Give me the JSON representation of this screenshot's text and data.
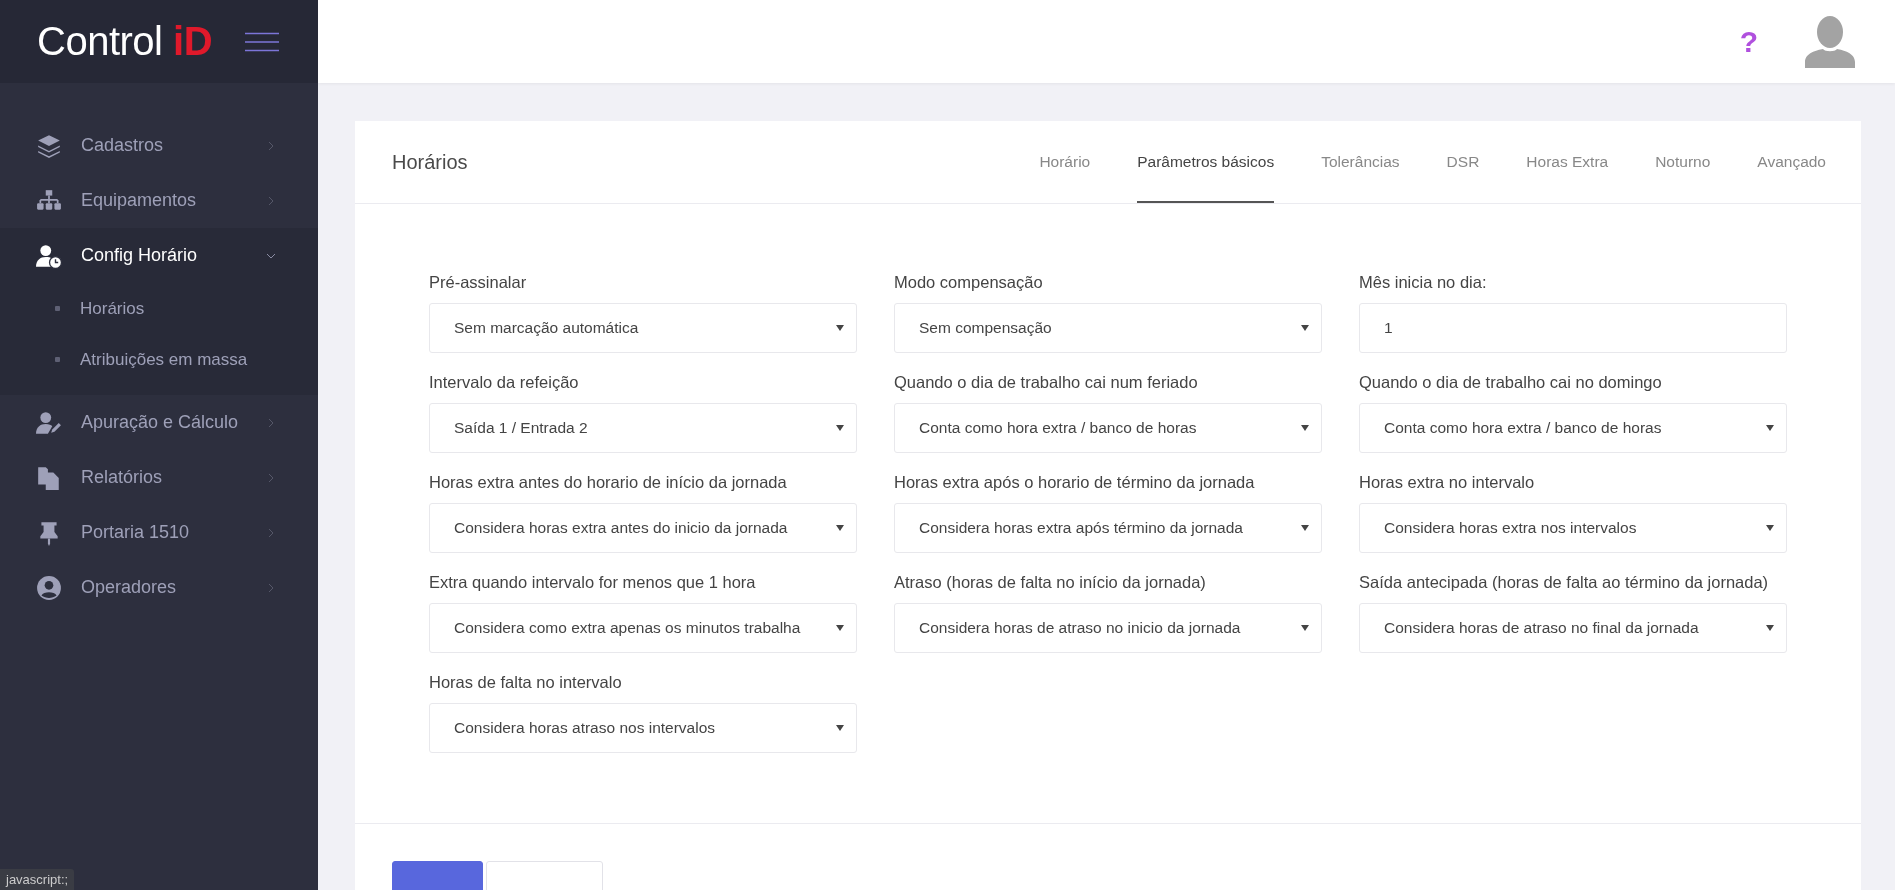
{
  "brand": {
    "name": "Control",
    "accent": "iD"
  },
  "topbar": {
    "help": "?"
  },
  "sidebar": {
    "items": [
      {
        "label": "Cadastros",
        "expanded": false
      },
      {
        "label": "Equipamentos",
        "expanded": false
      },
      {
        "label": "Config Horário",
        "expanded": true,
        "children": [
          {
            "label": "Horários"
          },
          {
            "label": "Atribuições em massa"
          }
        ]
      },
      {
        "label": "Apuração e Cálculo",
        "expanded": false
      },
      {
        "label": "Relatórios",
        "expanded": false
      },
      {
        "label": "Portaria 1510",
        "expanded": false
      },
      {
        "label": "Operadores",
        "expanded": false
      }
    ]
  },
  "card": {
    "title": "Horários",
    "tabs": [
      {
        "label": "Horário",
        "selected": false
      },
      {
        "label": "Parâmetros básicos",
        "selected": true
      },
      {
        "label": "Tolerâncias",
        "selected": false
      },
      {
        "label": "DSR",
        "selected": false
      },
      {
        "label": "Horas Extra",
        "selected": false
      },
      {
        "label": "Noturno",
        "selected": false
      },
      {
        "label": "Avançado",
        "selected": false
      }
    ],
    "fields": [
      {
        "label": "Pré-assinalar",
        "kind": "select",
        "value": "Sem marcação automática"
      },
      {
        "label": "Modo compensação",
        "kind": "select",
        "value": "Sem compensação"
      },
      {
        "label": "Mês inicia no dia:",
        "kind": "input",
        "value": "1"
      },
      {
        "label": "Intervalo da refeição",
        "kind": "select",
        "value": "Saída 1 / Entrada 2"
      },
      {
        "label": "Quando o dia de trabalho cai num feriado",
        "kind": "select",
        "value": "Conta como hora extra / banco de horas"
      },
      {
        "label": "Quando o dia de trabalho cai no domingo",
        "kind": "select",
        "value": "Conta como hora extra / banco de horas"
      },
      {
        "label": "Horas extra antes do horario de início da jornada",
        "kind": "select",
        "value": "Considera horas extra antes do inicio da jornada"
      },
      {
        "label": "Horas extra após o horario de término da jornada",
        "kind": "select",
        "value": "Considera horas extra após término da jornada"
      },
      {
        "label": "Horas extra no intervalo",
        "kind": "select",
        "value": "Considera horas extra nos intervalos"
      },
      {
        "label": "Extra quando intervalo for menos que 1 hora",
        "kind": "select",
        "value": "Considera como extra apenas os minutos trabalha"
      },
      {
        "label": "Atraso (horas de falta no início da jornada)",
        "kind": "select",
        "value": "Considera horas de atraso no inicio da jornada"
      },
      {
        "label": "Saída antecipada (horas de falta ao término da jornada)",
        "kind": "select",
        "value": "Considera horas de atraso no final da jornada"
      },
      {
        "label": "Horas de falta no intervalo",
        "kind": "select",
        "value": "Considera horas atraso nos intervalos"
      }
    ],
    "buttons": [
      {
        "kind": "primary"
      },
      {
        "kind": "secondary"
      }
    ]
  },
  "status_bar": "javascript:;"
}
